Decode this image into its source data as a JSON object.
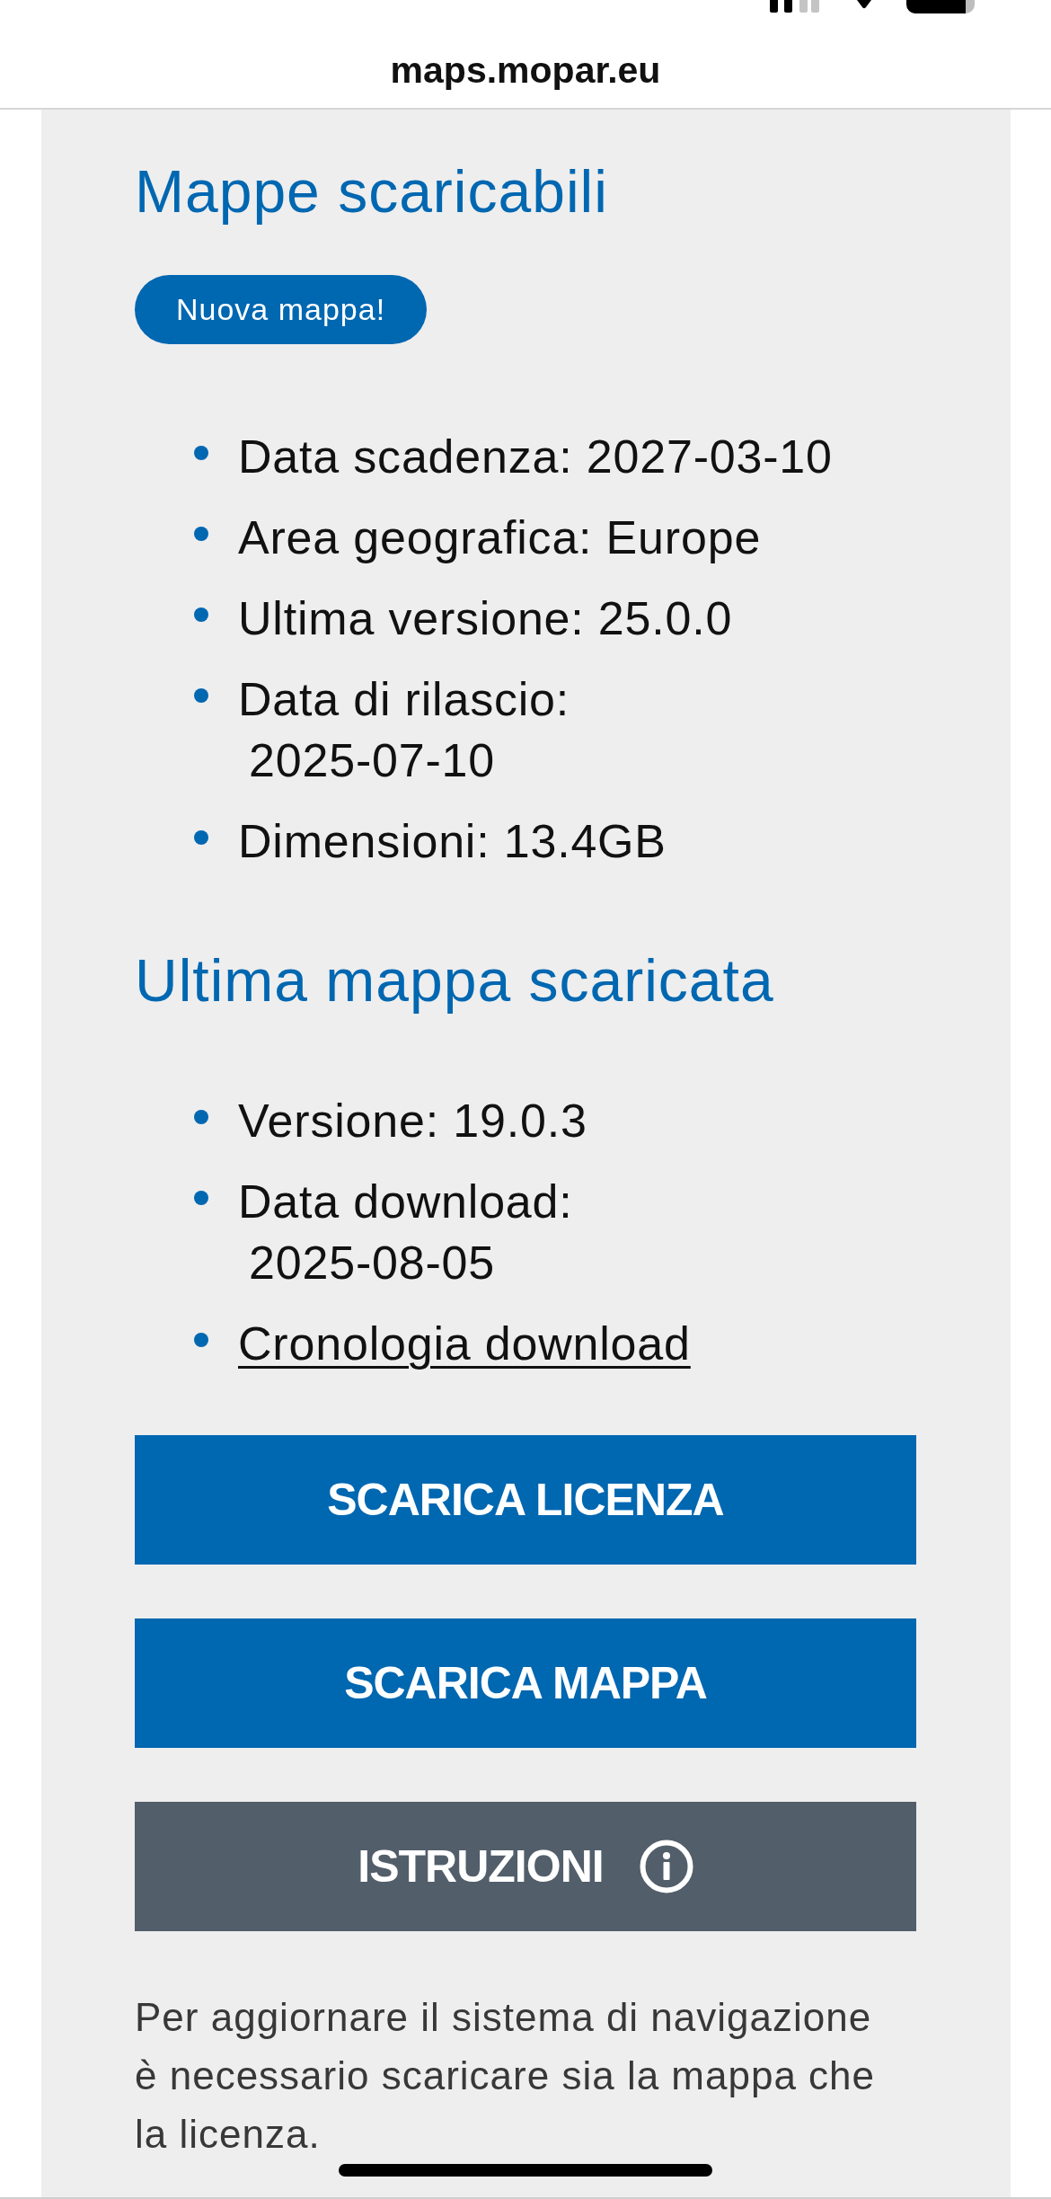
{
  "browser": {
    "url": "maps.mopar.eu"
  },
  "sections": [
    {
      "title": "Mappe scaricabili",
      "badge": "Nuova mappa!",
      "items": [
        {
          "kind": "inline",
          "text": "Data scadenza: 2027-03-10"
        },
        {
          "kind": "inline",
          "text": "Area geografica: Europe"
        },
        {
          "kind": "inline",
          "text": "Ultima versione: 25.0.0"
        },
        {
          "kind": "stacked",
          "label": "Data di rilascio:",
          "value": "2025-07-10"
        },
        {
          "kind": "inline",
          "text": "Dimensioni: 13.4GB"
        }
      ]
    },
    {
      "title": "Ultima mappa scaricata",
      "items": [
        {
          "kind": "inline",
          "text": "Versione: 19.0.3"
        },
        {
          "kind": "stacked",
          "label": "Data download:",
          "value": "2025-08-05"
        },
        {
          "kind": "link",
          "text": "Cronologia download"
        }
      ]
    }
  ],
  "buttons": [
    {
      "kind": "primary",
      "label": "SCARICA LICENZA"
    },
    {
      "kind": "primary",
      "label": "SCARICA MAPPA"
    },
    {
      "kind": "info",
      "label": "ISTRUZIONI"
    }
  ],
  "note": "Per aggiornare il sistema di navigazione è necessario scaricare sia la mappa che la licenza."
}
